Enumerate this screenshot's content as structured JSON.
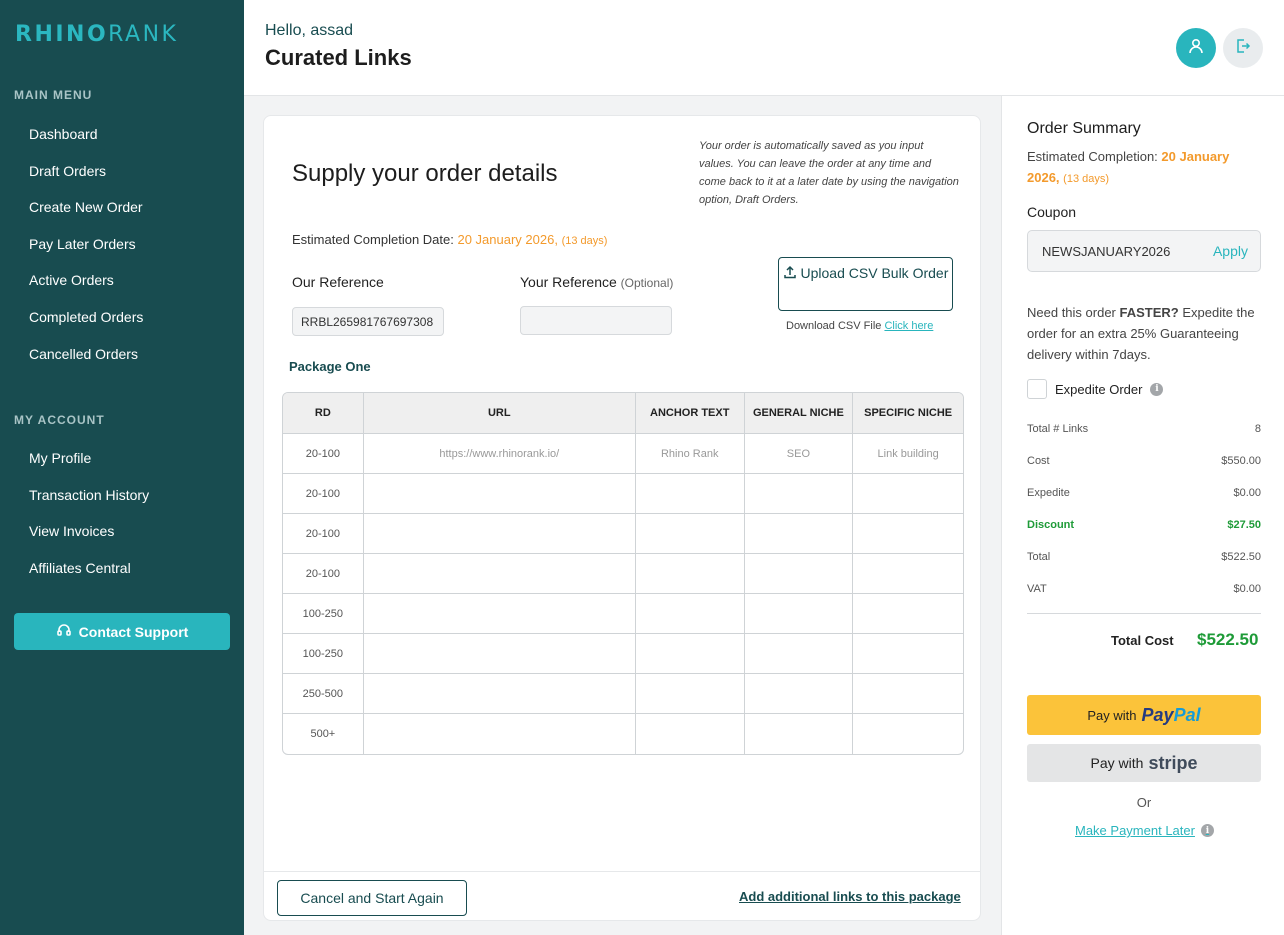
{
  "sidebar": {
    "logo": {
      "part1": "RHINO",
      "part2": "RANK"
    },
    "main_menu_title": "MAIN MENU",
    "main_items": [
      "Dashboard",
      "Draft Orders",
      "Create New Order",
      "Pay Later Orders",
      "Active Orders",
      "Completed Orders",
      "Cancelled Orders"
    ],
    "account_title": "MY ACCOUNT",
    "account_items": [
      "My Profile",
      "Transaction History",
      "View Invoices",
      "Affiliates Central"
    ],
    "support_label": "Contact Support"
  },
  "header": {
    "greeting": "Hello, assad",
    "title": "Curated Links"
  },
  "main": {
    "title": "Supply your order details",
    "autosave_note": "Your order is automatically saved as you input values. You can leave the order at any time and come back to it at a later date by using the navigation option, Draft Orders.",
    "est_label": "Estimated Completion Date:",
    "est_date": "20 January 2026,",
    "est_days": "(13 days)",
    "our_ref_label": "Our Reference",
    "our_ref_value": "RRBL265981767697308",
    "your_ref_label": "Your Reference",
    "your_ref_optional": "(Optional)",
    "your_ref_value": "",
    "csv_button": "Upload CSV Bulk Order",
    "csv_download_text": "Download CSV File",
    "csv_download_link": "Click here",
    "package_title": "Package One",
    "table": {
      "headers": [
        "RD",
        "URL",
        "ANCHOR TEXT",
        "GENERAL NICHE",
        "SPECIFIC NICHE"
      ],
      "rows": [
        [
          "20-100",
          "https://www.rhinorank.io/",
          "Rhino Rank",
          "SEO",
          "Link building"
        ],
        [
          "20-100",
          "",
          "",
          "",
          ""
        ],
        [
          "20-100",
          "",
          "",
          "",
          ""
        ],
        [
          "20-100",
          "",
          "",
          "",
          ""
        ],
        [
          "100-250",
          "",
          "",
          "",
          ""
        ],
        [
          "100-250",
          "",
          "",
          "",
          ""
        ],
        [
          "250-500",
          "",
          "",
          "",
          ""
        ],
        [
          "500+",
          "",
          "",
          "",
          ""
        ]
      ]
    },
    "cancel_button": "Cancel and Start Again",
    "add_links": "Add additional links to this package"
  },
  "summary": {
    "title": "Order Summary",
    "est_label": "Estimated Completion:",
    "est_date": "20 January 2026,",
    "est_days": "(13 days)",
    "coupon_label": "Coupon",
    "coupon_code": "NEWSJANUARY2026",
    "apply_label": "Apply",
    "faster_pre": "Need this order ",
    "faster_bold": "FASTER?",
    "faster_post": " Expedite the order for an extra 25% Guaranteeing delivery within 7days.",
    "expedite_label": "Expedite Order",
    "expedite_checked": false,
    "rows": [
      {
        "label": "Total # Links",
        "value": "8"
      },
      {
        "label": "Cost",
        "value": "$550.00"
      },
      {
        "label": "Expedite",
        "value": "$0.00"
      },
      {
        "label": "Discount",
        "value": "$27.50"
      },
      {
        "label": "Total",
        "value": "$522.50"
      },
      {
        "label": "VAT",
        "value": "$0.00"
      }
    ],
    "total_label": "Total Cost",
    "total_value": "$522.50",
    "paypal_pre": "Pay with",
    "paypal_brand1": "Pay",
    "paypal_brand2": "Pal",
    "stripe_pre": "Pay with",
    "stripe_brand": "stripe",
    "or": "Or",
    "pay_later": "Make Payment Later"
  },
  "colors": {
    "sidebar": "#184c50",
    "accent": "#29b5bd",
    "orange": "#f39a2c",
    "green": "#1e9b38",
    "paypal": "#fbc33a"
  }
}
